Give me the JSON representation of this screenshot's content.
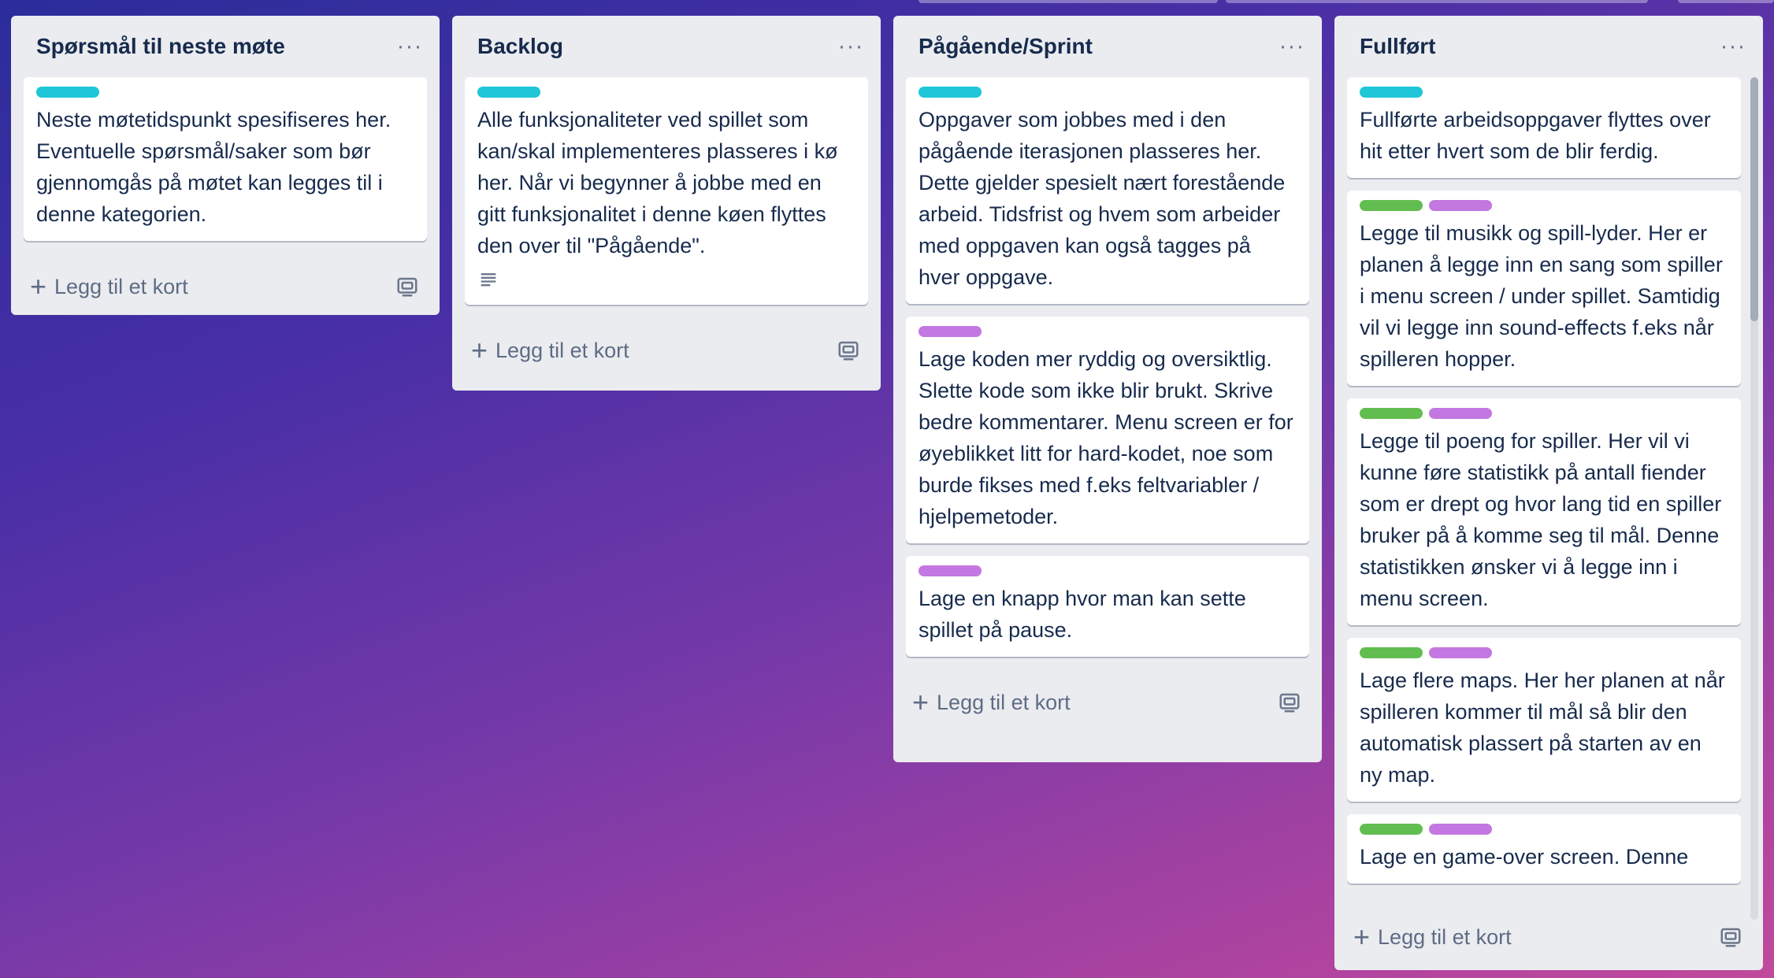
{
  "colors": {
    "label_cyan": "#1ec6d8",
    "label_green": "#61bd4f",
    "label_purple": "#c377e0"
  },
  "icons": {
    "list_menu": "ellipsis-icon",
    "add": "plus-icon",
    "template": "card-template-icon",
    "description": "description-icon"
  },
  "lists": [
    {
      "title": "Spørsmål til neste møte",
      "menu_label": "···",
      "add_label": "Legg til et kort",
      "cards": [
        {
          "labels": [
            "cyan"
          ],
          "text": "Neste møtetidspunkt spesifiseres her. Eventuelle spørsmål/saker som bør gjennomgås på møtet kan legges til i denne kategorien."
        }
      ]
    },
    {
      "title": "Backlog",
      "menu_label": "···",
      "add_label": "Legg til et kort",
      "cards": [
        {
          "labels": [
            "cyan"
          ],
          "text": "Alle funksjonaliteter ved spillet som kan/skal implementeres plasseres i kø her. Når vi begynner å jobbe med en gitt funksjonalitet i denne køen flyttes den over til \"Pågående\"."
        }
      ]
    },
    {
      "title": "Pågående/Sprint",
      "menu_label": "···",
      "add_label": "Legg til et kort",
      "cards": [
        {
          "labels": [
            "cyan"
          ],
          "text": "Oppgaver som jobbes med i den pågående iterasjonen plasseres her. Dette gjelder spesielt nært forestående arbeid. Tidsfrist og hvem som arbeider med oppgaven kan også tagges på hver oppgave."
        },
        {
          "labels": [
            "purple"
          ],
          "text": "Lage koden mer ryddig og oversiktlig. Slette kode som ikke blir brukt. Skrive bedre kommentarer. Menu screen er for øyeblikket litt for hard-kodet, noe som burde fikses med f.eks feltvariabler / hjelpemetoder."
        },
        {
          "labels": [
            "purple"
          ],
          "text": "Lage en knapp hvor man kan sette spillet på pause."
        }
      ]
    },
    {
      "title": "Fullført",
      "menu_label": "···",
      "add_label": "Legg til et kort",
      "cards": [
        {
          "labels": [
            "cyan"
          ],
          "text": "Fullførte arbeidsoppgaver flyttes over hit etter hvert som de blir ferdig."
        },
        {
          "labels": [
            "green",
            "purple"
          ],
          "text": "Legge til musikk og spill-lyder. Her er planen å legge inn en sang som spiller i menu screen / under spillet. Samtidig vil vi legge inn sound-effects f.eks når spilleren hopper."
        },
        {
          "labels": [
            "green",
            "purple"
          ],
          "text": "Legge til poeng for spiller. Her vil vi kunne føre statistikk på antall fiender som er drept og hvor lang tid en spiller bruker på å komme seg til mål. Denne statistikken ønsker vi å legge inn i menu screen."
        },
        {
          "labels": [
            "green",
            "purple"
          ],
          "text": "Lage flere maps. Her her planen at når spilleren kommer til mål så blir den automatisk plassert på starten av en ny map."
        },
        {
          "labels": [
            "green",
            "purple"
          ],
          "text": "Lage en game-over screen. Denne"
        }
      ]
    }
  ]
}
